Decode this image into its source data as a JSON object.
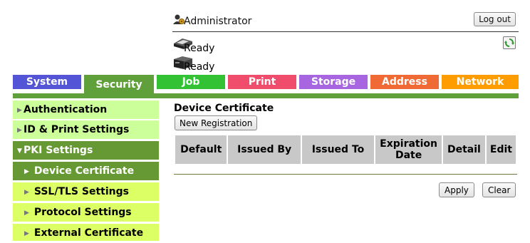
{
  "header": {
    "user_name": "Administrator",
    "logout_label": "Log out"
  },
  "status": {
    "printer": "Ready",
    "scanner": "Ready"
  },
  "tabs": [
    {
      "label": "System",
      "color": "#5454d6"
    },
    {
      "label": "Security",
      "color": "#5fa03a"
    },
    {
      "label": "Job",
      "color": "#33c233"
    },
    {
      "label": "Print",
      "color": "#f04d6d"
    },
    {
      "label": "Storage",
      "color": "#a865e0"
    },
    {
      "label": "Address",
      "color": "#ef6a35"
    },
    {
      "label": "Network",
      "color": "#ff9d00"
    }
  ],
  "sidebar": {
    "items": [
      {
        "label": "Authentication"
      },
      {
        "label": "ID & Print Settings"
      },
      {
        "label": "PKI Settings"
      },
      {
        "label": "Device Certificate"
      },
      {
        "label": "SSL/TLS Settings"
      },
      {
        "label": "Protocol Settings"
      },
      {
        "label": "External Certificate"
      }
    ]
  },
  "main": {
    "title": "Device Certificate",
    "new_registration_label": "New Registration",
    "table": {
      "columns": [
        "Default",
        "Issued By",
        "Issued To",
        "Expiration Date",
        "Detail",
        "Edit"
      ],
      "rows": []
    },
    "apply_label": "Apply",
    "clear_label": "Clear"
  },
  "icons": {
    "user": "user-icon",
    "printer": "printer-icon",
    "scanner": "scanner-icon",
    "refresh": "refresh-icon"
  },
  "colors": {
    "sidebar_light": "#ccff99",
    "sidebar_dark": "#669933",
    "sidebar_sub_light": "#ddff66",
    "tab_underline": "#5fa03a"
  }
}
